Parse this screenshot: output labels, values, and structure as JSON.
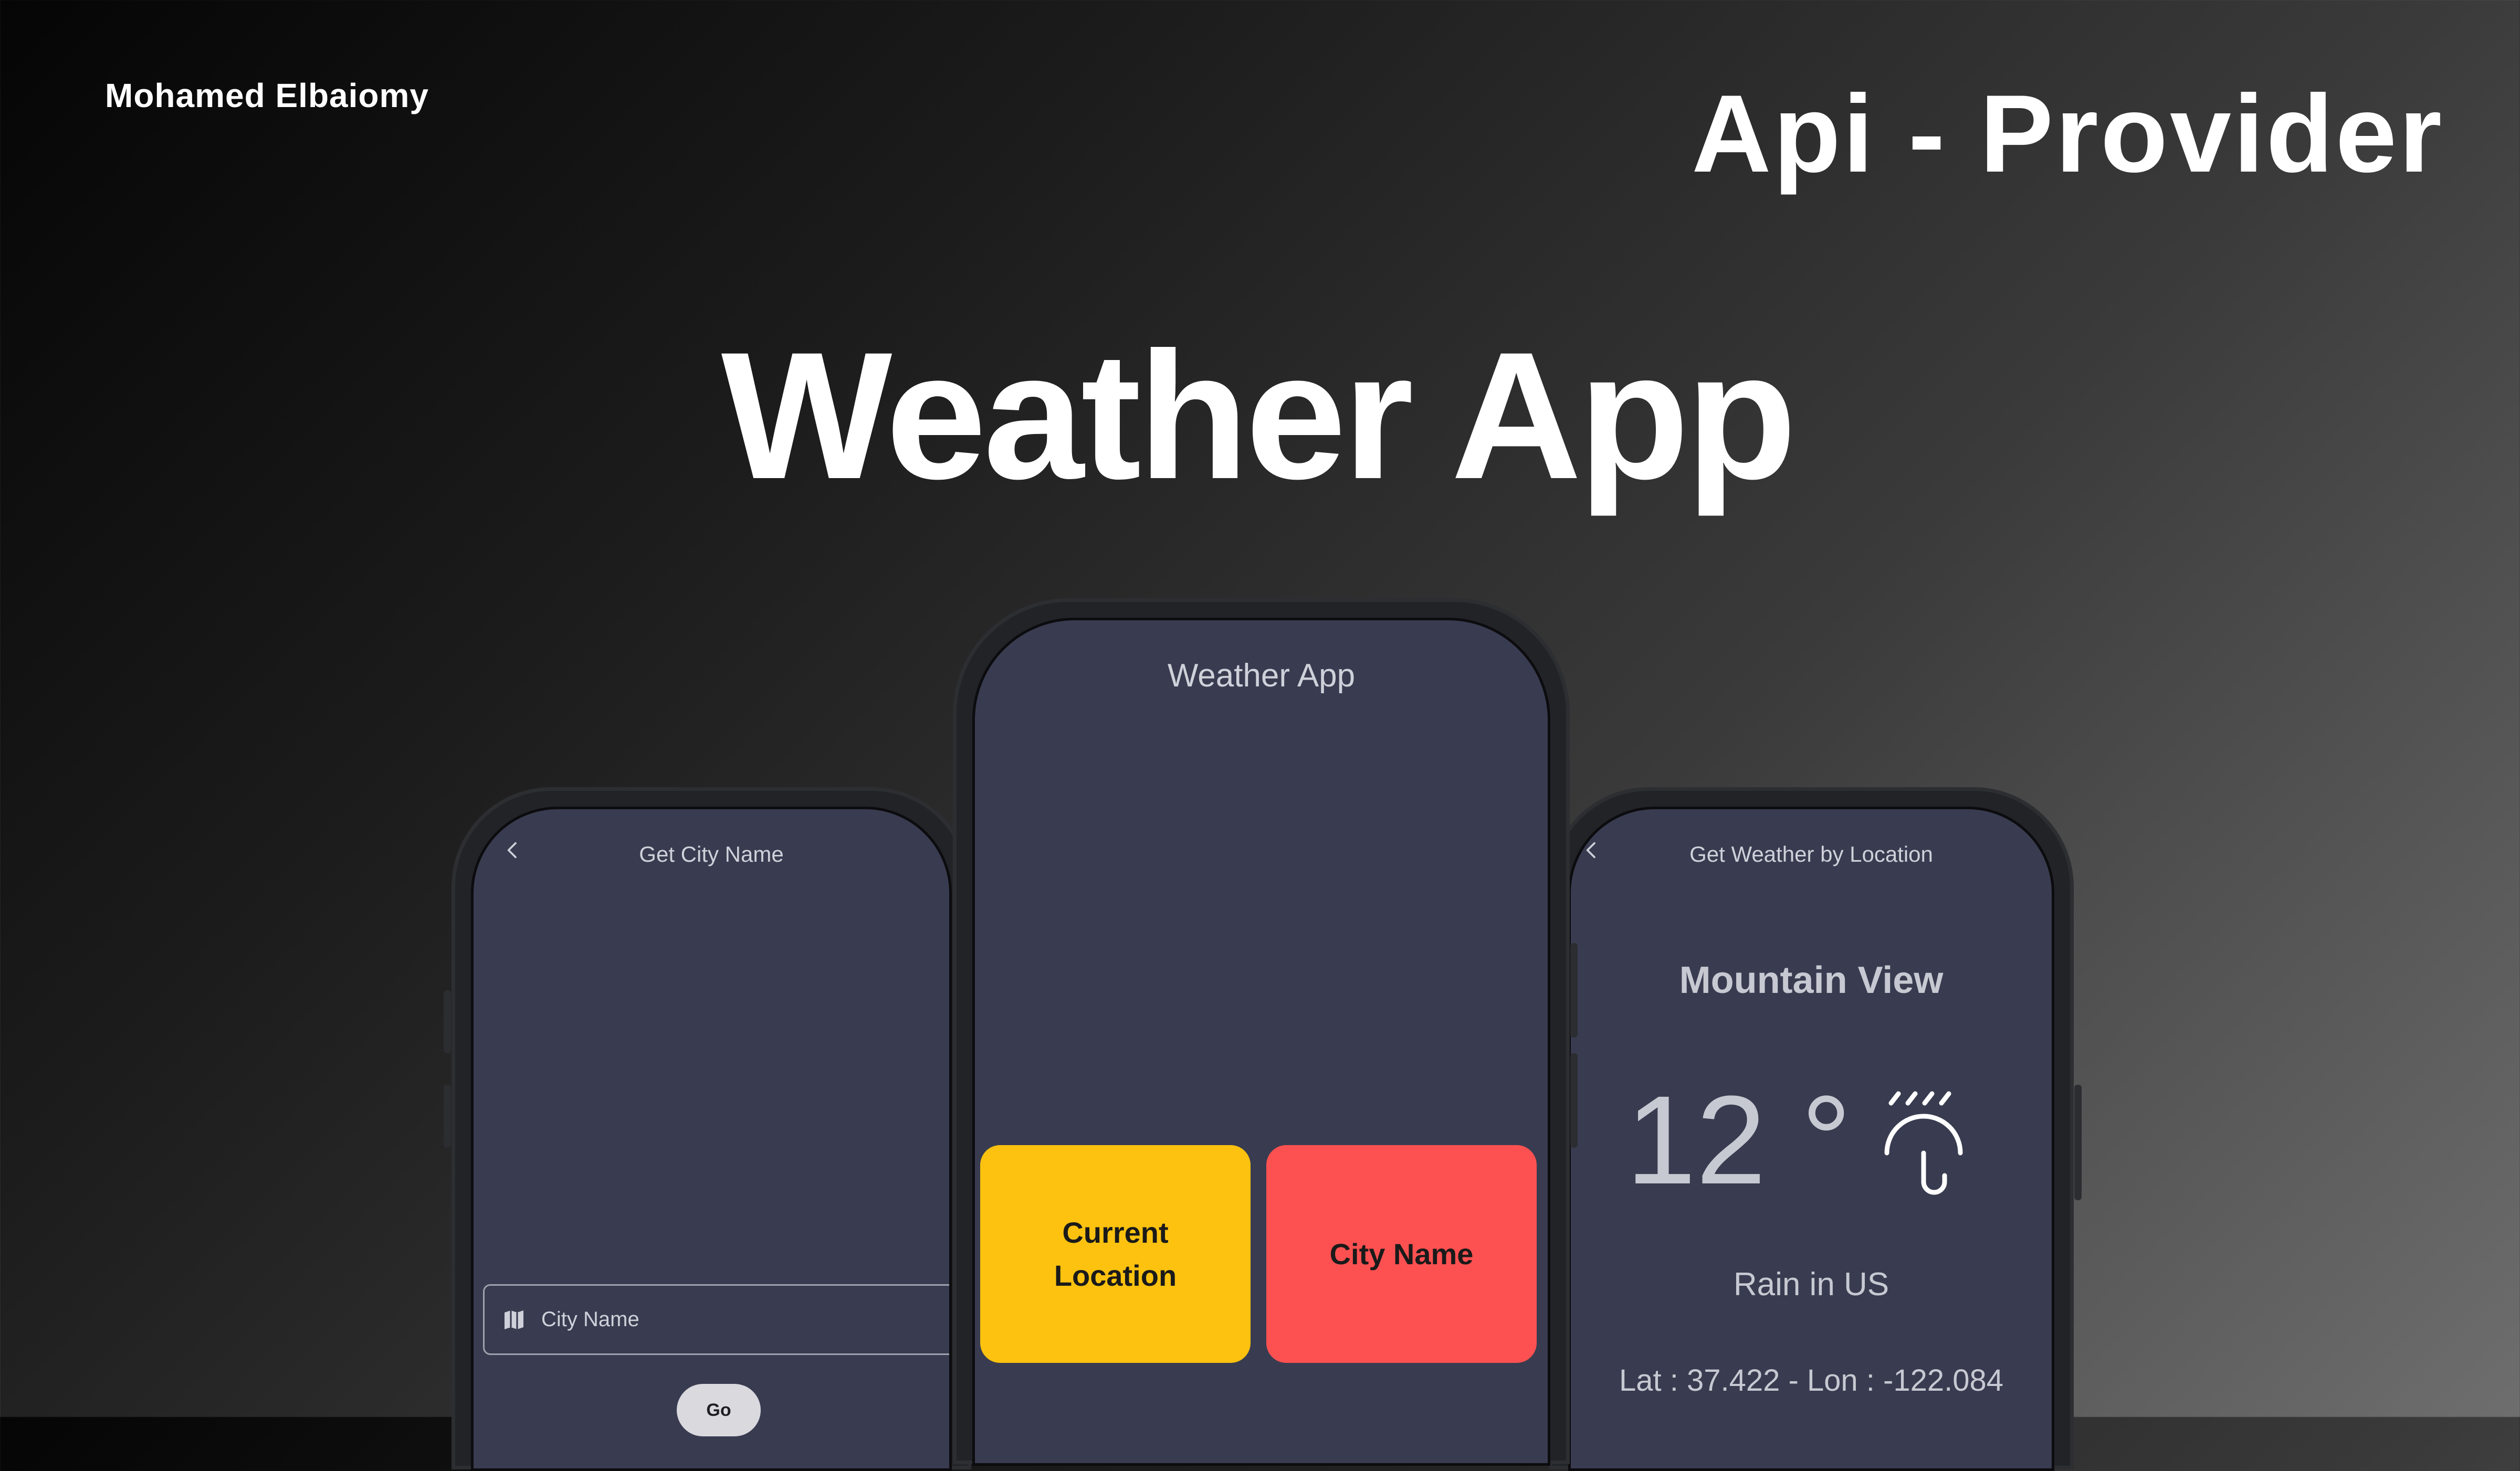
{
  "header": {
    "author": "Mohamed Elbaiomy",
    "subtitle": "Api - Provider",
    "title": "Weather App"
  },
  "left_phone": {
    "title": "Get City Name",
    "back_icon": "chevron-left-icon",
    "input_icon": "map-icon",
    "input_placeholder": "City Name",
    "button_label": "Go"
  },
  "center_phone": {
    "title": "Weather App",
    "tiles": [
      {
        "label": "Current Location",
        "color": "#fcc20f"
      },
      {
        "label": "City Name",
        "color": "#fd5151"
      }
    ]
  },
  "right_phone": {
    "title": "Get Weather by Location",
    "back_icon": "chevron-left-icon",
    "city": "Mountain View",
    "temperature": "12 °",
    "weather_icon": "rain-umbrella-icon",
    "description": "Rain in US",
    "coordinates": "Lat : 37.422 - Lon : -122.084"
  },
  "colors": {
    "screen_bg": "#393c50",
    "text_muted": "#c7c9d2"
  }
}
